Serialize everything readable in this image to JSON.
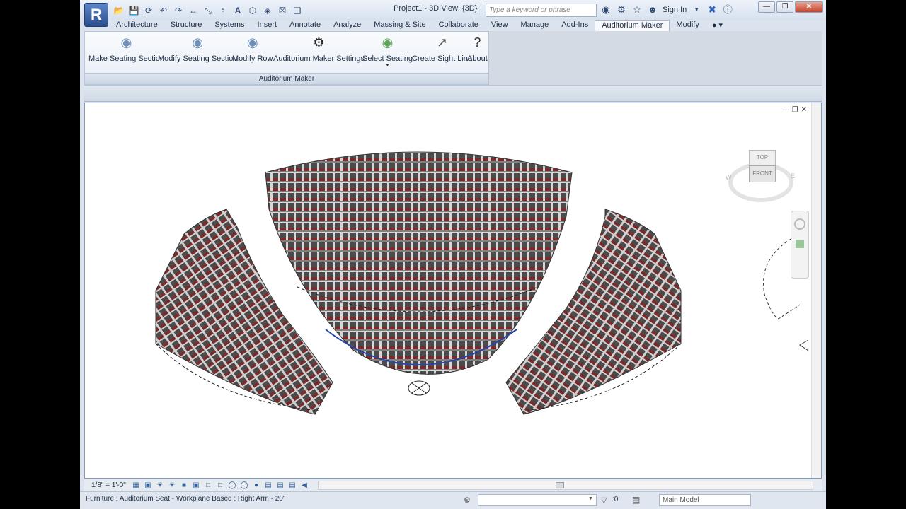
{
  "app": {
    "logo_letter": "R",
    "window_title": "Project1 - 3D View: {3D}",
    "search_placeholder": "Type a keyword or phrase",
    "sign_in": "Sign In",
    "qat_icons": [
      "open-icon",
      "save-icon",
      "sync-icon",
      "undo-icon",
      "redo-icon",
      "measure-icon",
      "dimension-icon",
      "tag-icon",
      "text-icon",
      "3d-view-icon",
      "section-icon",
      "close-hidden-icon",
      "switch-windows-icon"
    ]
  },
  "tabs": [
    {
      "label": "Architecture"
    },
    {
      "label": "Structure"
    },
    {
      "label": "Systems"
    },
    {
      "label": "Insert"
    },
    {
      "label": "Annotate"
    },
    {
      "label": "Analyze"
    },
    {
      "label": "Massing & Site"
    },
    {
      "label": "Collaborate"
    },
    {
      "label": "View"
    },
    {
      "label": "Manage"
    },
    {
      "label": "Add-Ins"
    },
    {
      "label": "Auditorium Maker",
      "active": true
    },
    {
      "label": "Modify"
    }
  ],
  "ribbon": {
    "panel_title": "Auditorium Maker",
    "buttons": [
      {
        "label": "Make Seating Section",
        "icon": "seating-section-icon"
      },
      {
        "label": "Modify Seating Section",
        "icon": "modify-section-icon"
      },
      {
        "label": "Modify Row",
        "icon": "modify-row-icon"
      },
      {
        "label": "Auditorium Maker Settings",
        "icon": "settings-gear-icon"
      },
      {
        "label": "Select Seating",
        "icon": "select-seating-icon"
      },
      {
        "label": "Create Sight Line",
        "icon": "sight-line-icon"
      },
      {
        "label": "About",
        "icon": "about-icon"
      }
    ]
  },
  "viewcube": {
    "top": "TOP",
    "front": "FRONT",
    "west": "W",
    "east": "E"
  },
  "view_control": {
    "scale": "1/8\" = 1'-0\""
  },
  "status": {
    "text": "Furniture : Auditorium Seat - Workplane Based : Right Arm - 20\"",
    "selection_count": ":0",
    "workset": "Main Model"
  }
}
